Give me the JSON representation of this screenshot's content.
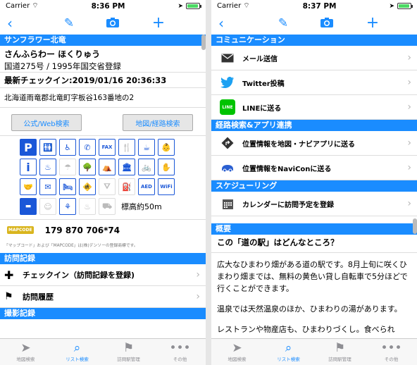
{
  "left": {
    "status": {
      "carrier": "Carrier",
      "time": "8:36 PM"
    },
    "station": {
      "section_title": "サンフラワー北竜",
      "reading": "さんふらわー ほくりゅう",
      "route": "国道275号 / 1995年国交省登録",
      "checkin": "最新チェックイン:2019/01/16 20:36:33",
      "address": "北海道雨竜郡北竜町字板谷163番地の2",
      "web_button": "公式/Web検索",
      "map_button": "地図/経路検索",
      "elevation": "標高約50m",
      "mapcode_logo": "MAPCODE",
      "mapcode": "179 870 706*74",
      "mapcode_note": "「マップコード」および「MAPCODE」は(株)デンソーの登録商標です。"
    },
    "visit_section": "訪問記録",
    "checkin_item": "チェックイン（訪問記録を登録)",
    "history_item": "訪問履歴",
    "photo_section": "撮影記録"
  },
  "right": {
    "status": {
      "carrier": "Carrier",
      "time": "8:37 PM"
    },
    "comm_section": "コミュニケーション",
    "mail_item": "メール送信",
    "twitter_item": "Twitter投稿",
    "line_item": "LINEに送る",
    "line_logo": "LINE",
    "route_section": "経路検索&アプリ連携",
    "map_app_item": "位置情報を地図・ナビアプリに送る",
    "navicon_item": "位置情報をNaviConに送る",
    "sched_section": "スケジューリング",
    "calendar_item": "カレンダーに訪問予定を登録",
    "overview_section": "概要",
    "overview_title": "この「道の駅」はどんなところ？",
    "para1": "広大なひまわり畑がある道の駅です。8月上旬に咲くひまわり畑までは、無料の黄色い貸し自転車で5分ほどで行くことができます。",
    "para2": "温泉では天然温泉のほか、ひまわりの湯があります。",
    "para3": "レストランや物産店も、ひまわりづくし。食べられ"
  },
  "tabs": [
    {
      "label": "地図検索",
      "icon": "navigation-arrow-icon"
    },
    {
      "label": "リスト検索",
      "icon": "search-icon"
    },
    {
      "label": "訪問駅管理",
      "icon": "flag-icon"
    },
    {
      "label": "その他",
      "icon": "more-icon"
    }
  ],
  "facility_icons": [
    "P",
    "🚻",
    "♿",
    "📞",
    "FAX",
    "🍴",
    "☕",
    "👶",
    "i",
    "♨",
    "🚿",
    "🌳",
    "⛺",
    "🏛",
    "🚲",
    "🤲",
    "🤝",
    "✉",
    "🛏",
    "🚼",
    "🛣",
    "⛽",
    "AED",
    "WiFi",
    "▬",
    "👤",
    "🧺",
    "♨",
    "🚗"
  ],
  "colors": {
    "accent": "#1a8cff",
    "facility": "#1a57d8"
  }
}
